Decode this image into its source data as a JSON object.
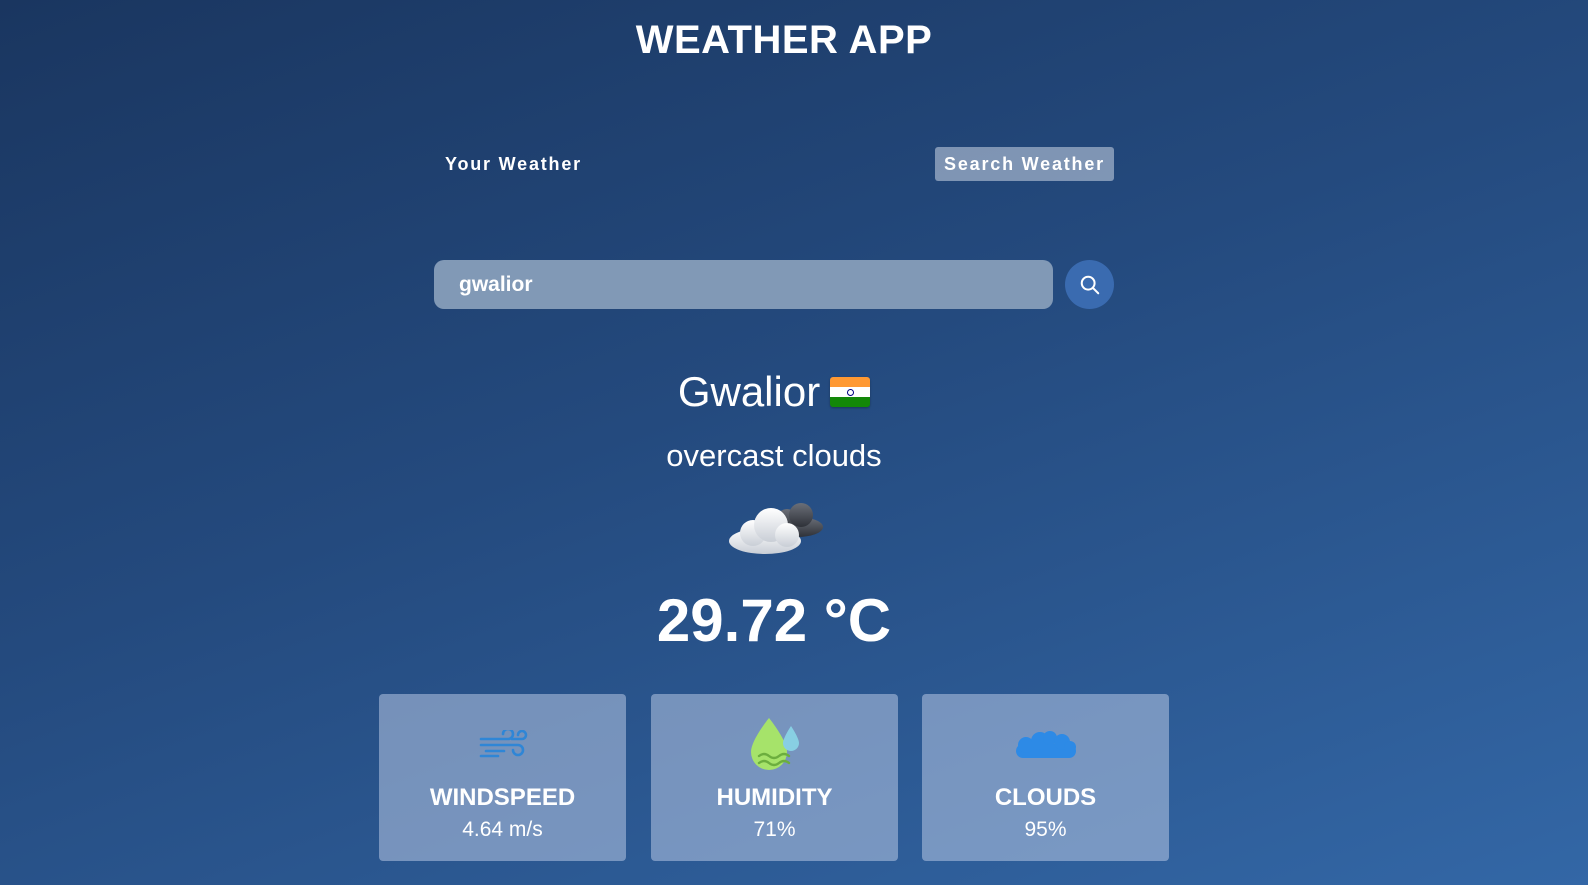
{
  "header": {
    "title": "WEATHER APP"
  },
  "tabs": {
    "your_weather": "Your Weather",
    "search_weather": "Search Weather",
    "active": "search_weather"
  },
  "search": {
    "value": "gwalior",
    "icon": "search-icon"
  },
  "weather": {
    "city": "Gwalior",
    "country_flag": "india-flag-icon",
    "description": "overcast clouds",
    "icon": "overcast-clouds-icon",
    "temperature": "29.72 °C"
  },
  "stats": {
    "windspeed": {
      "label": "WINDSPEED",
      "value": "4.64 m/s",
      "icon": "wind-icon"
    },
    "humidity": {
      "label": "HUMIDITY",
      "value": "71%",
      "icon": "humidity-icon"
    },
    "clouds": {
      "label": "CLOUDS",
      "value": "95%",
      "icon": "cloud-icon"
    }
  },
  "colors": {
    "background_top": "#1a3660",
    "background_bottom": "#3367a6",
    "search_button": "#3a6bb0",
    "search_input": "#8199b6",
    "card": "#8aa3c6"
  }
}
